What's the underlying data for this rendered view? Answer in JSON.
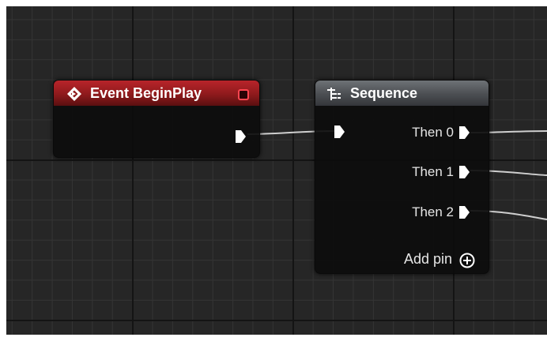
{
  "event_node": {
    "title": "Event BeginPlay",
    "title_icon": "event-diamond-icon",
    "header_color": "#9b1c1f",
    "status_icon": "stop-square-icon"
  },
  "sequence_node": {
    "title": "Sequence",
    "title_icon": "sequence-icon",
    "header_color": "#4b4e52",
    "outputs": [
      {
        "label": "Then 0"
      },
      {
        "label": "Then 1"
      },
      {
        "label": "Then 2"
      }
    ],
    "add_pin_label": "Add pin",
    "add_pin_icon": "plus-circle-icon"
  },
  "colors": {
    "canvas": "#262626",
    "wire": "#d0d0d0",
    "exec_pin": "#ffffff"
  }
}
